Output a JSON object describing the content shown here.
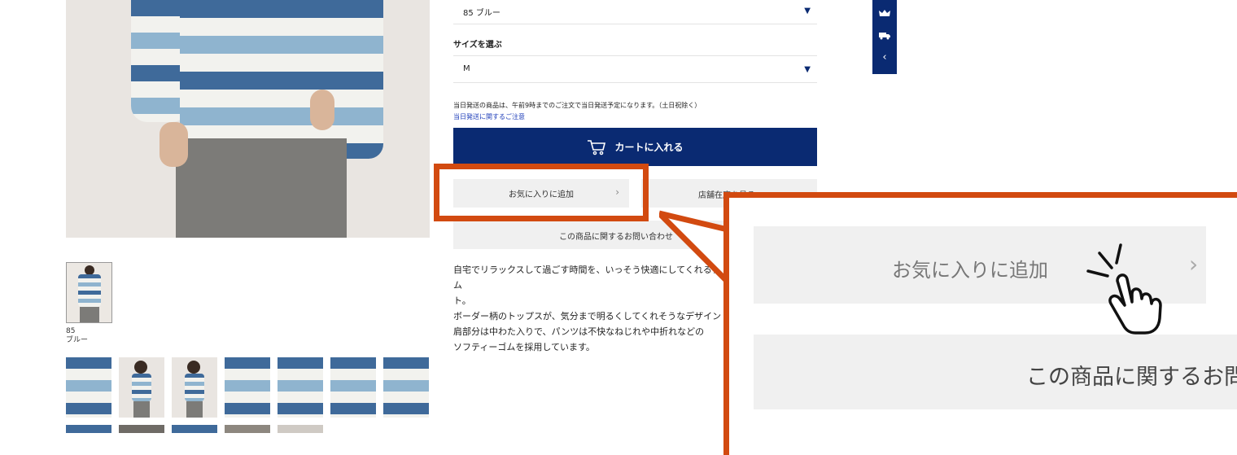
{
  "product": {
    "thumbnail_caption_1": "85",
    "thumbnail_caption_2": "ブルー"
  },
  "options": {
    "color_value": "85 ブルー",
    "size_label": "サイズを選ぶ",
    "size_value": "M"
  },
  "shipping": {
    "notice": "当日発送の商品は、午前9時までのご注文で当日発送予定になります。（土日祝除く）",
    "link": "当日発送に関するご注意"
  },
  "buttons": {
    "cart": "カートに入れる",
    "favorite": "お気に入りに追加",
    "store_stock": "店舗在庫を見る",
    "inquiry": "この商品に関するお問い合わせ"
  },
  "description": {
    "line1": "自宅でリラックスして過ごす時間を、いっそう快適にしてくれるアイテム",
    "line2": "ト。",
    "line3": "ボーダー柄のトップスが、気分まで明るくしてくれそうなデザイン",
    "line4": "肩部分は中わた入りで、パンツは不快なねじれや中折れなどの",
    "line5": "ソフティーゴムを採用しています。"
  },
  "zoom": {
    "favorite": "お気に入りに追加",
    "inquiry": "この商品に関するお問い合わせ"
  },
  "colors": {
    "navy": "#0a2a72",
    "highlight": "#d24a10",
    "button_gray": "#f0f0f0"
  },
  "icons": {
    "side_top": "crown-icon",
    "side_mid": "truck-icon",
    "side_bottom": "chevron-left-icon",
    "cart": "cart-icon",
    "pointer": "pointing-hand-icon"
  }
}
